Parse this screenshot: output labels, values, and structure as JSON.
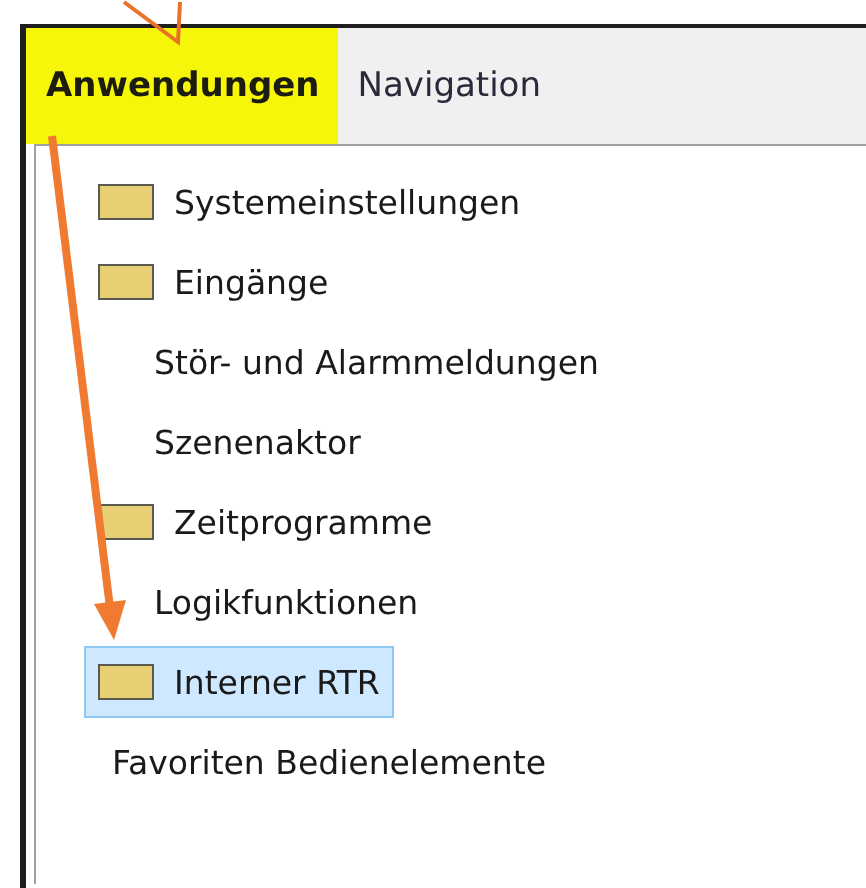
{
  "tabs": [
    {
      "label": "Anwendungen",
      "selected": true
    },
    {
      "label": "Navigation",
      "selected": false
    }
  ],
  "tree": {
    "items": [
      {
        "label": "Systemeinstellungen",
        "kind": "folder",
        "selected": false
      },
      {
        "label": "Eingänge",
        "kind": "folder",
        "selected": false
      },
      {
        "label": "Stör- und Alarmmeldungen",
        "kind": "plain",
        "selected": false
      },
      {
        "label": "Szenenaktor",
        "kind": "plain",
        "selected": false
      },
      {
        "label": "Zeitprogramme",
        "kind": "folder",
        "selected": false
      },
      {
        "label": "Logikfunktionen",
        "kind": "plain",
        "selected": false
      },
      {
        "label": "Interner RTR",
        "kind": "folder",
        "selected": true
      },
      {
        "label": "Favoriten Bedienelemente",
        "kind": "outer",
        "selected": false
      }
    ]
  }
}
